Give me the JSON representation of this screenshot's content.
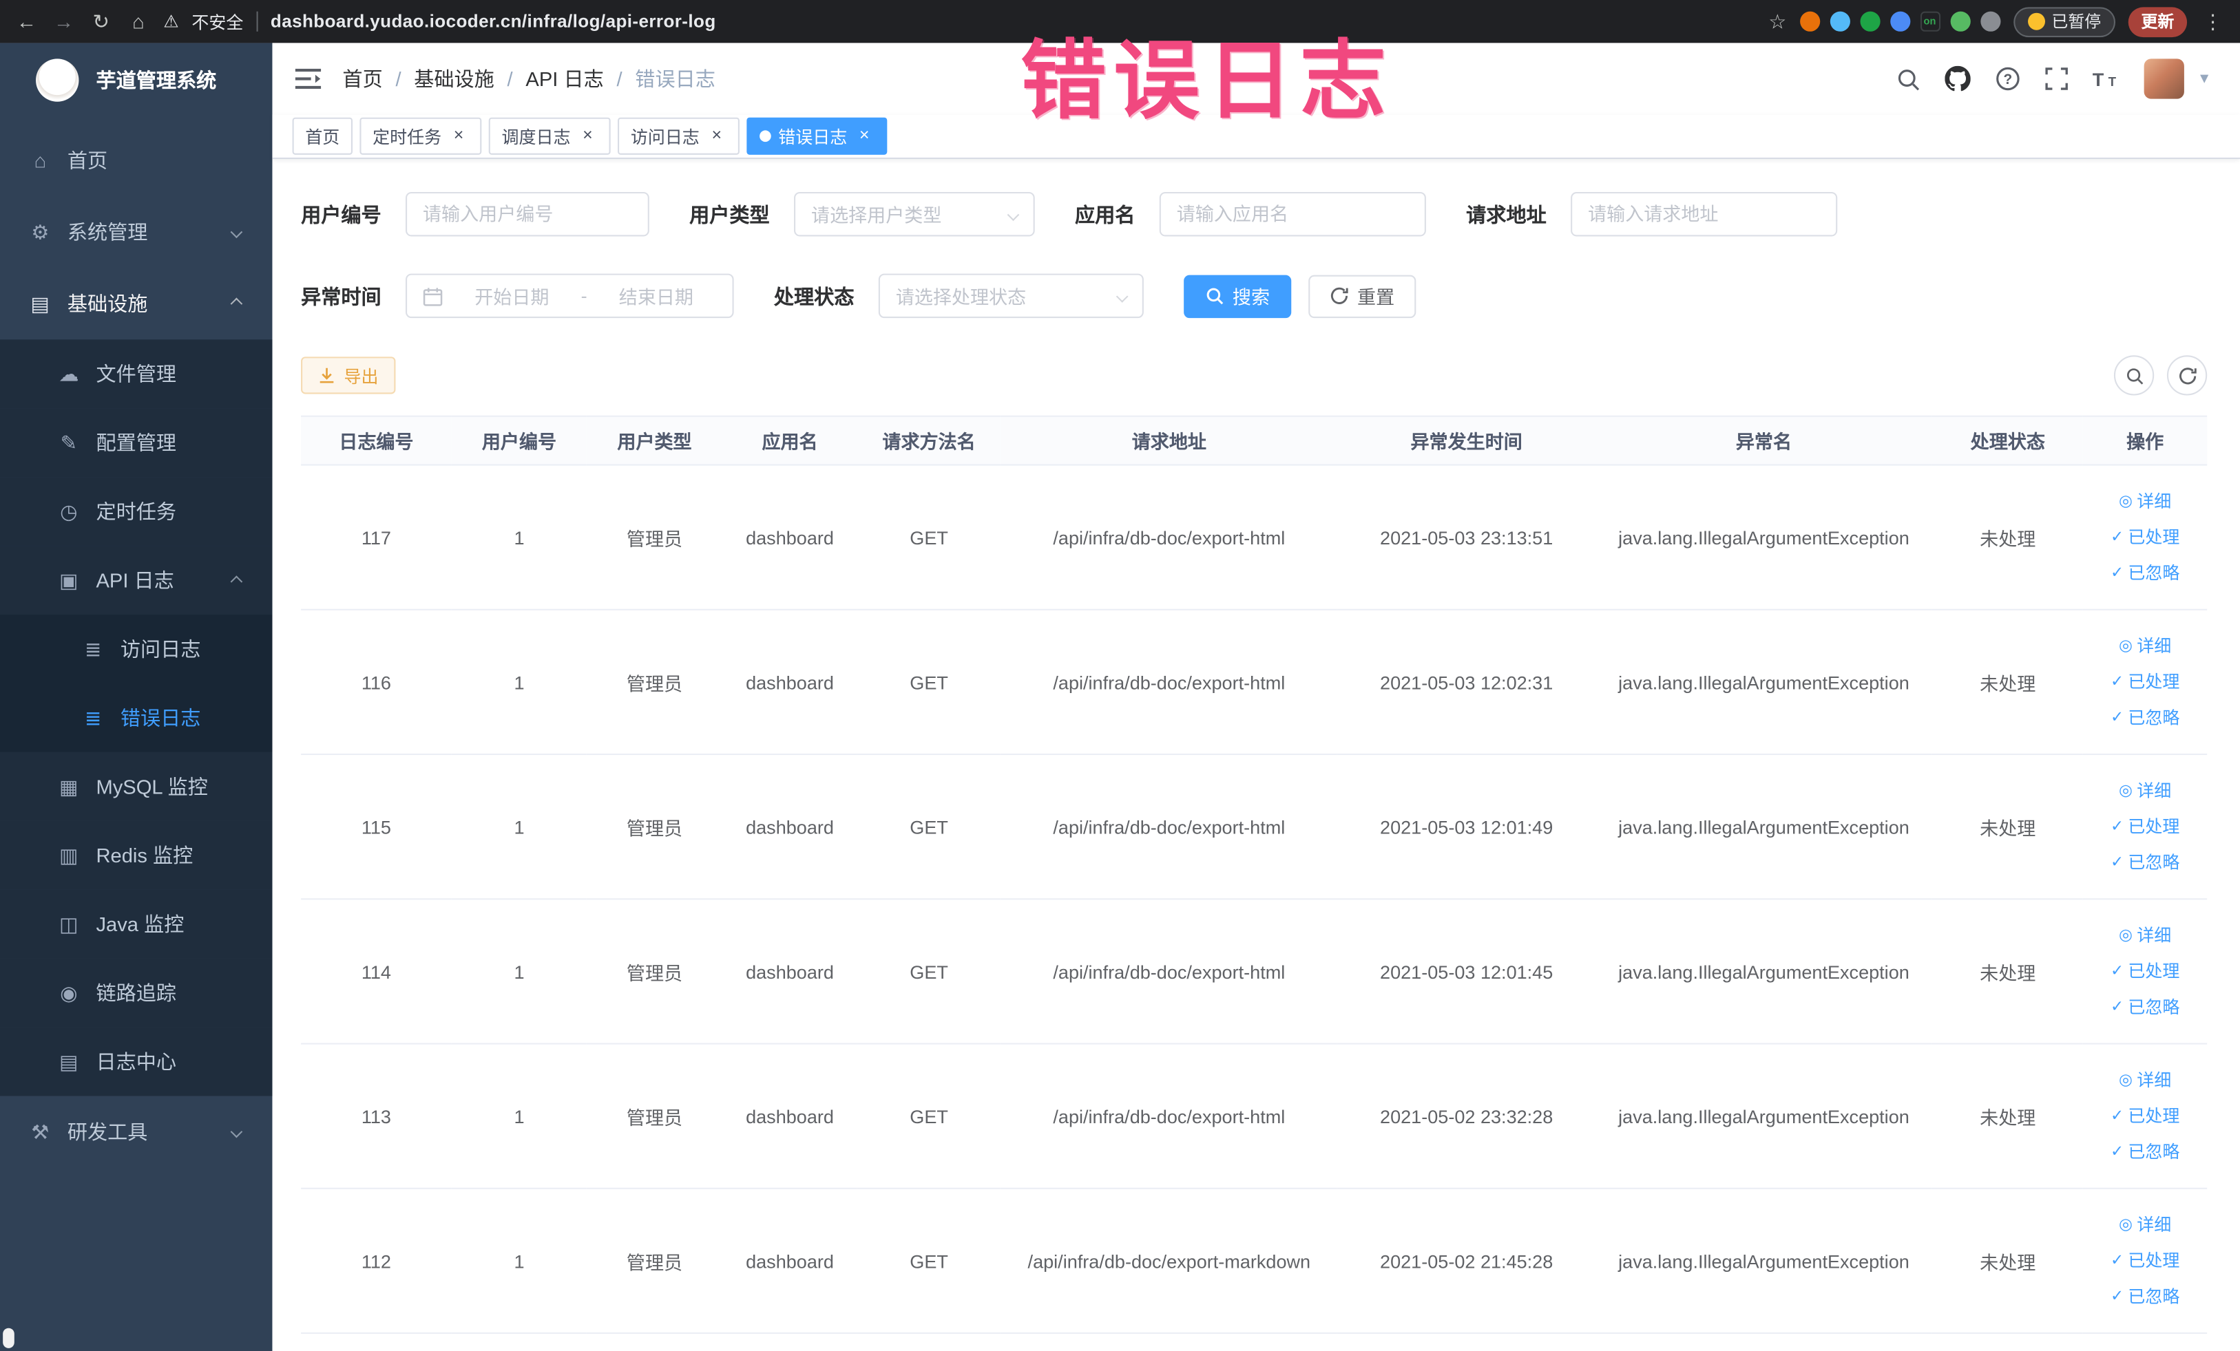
{
  "colors": {
    "primary": "#409EFF",
    "warning": "#e6a23c",
    "sidebar_bg": "#304156",
    "submenu_bg": "#1f2d3d",
    "annotation_pink": "#f1487f"
  },
  "annotation": {
    "text": "错误日志"
  },
  "browser": {
    "security_label": "不安全",
    "url": "dashboard.yudao.iocoder.cn/infra/log/api-error-log",
    "paused_label": "已暂停",
    "update_label": "更新",
    "extensions": [
      {
        "name": "extension-orange-icon",
        "color": "#e8710a"
      },
      {
        "name": "extension-blue-drop-icon",
        "color": "#54b9f7"
      },
      {
        "name": "extension-green-check-icon",
        "color": "#1ea446"
      },
      {
        "name": "extension-grid-icon",
        "color": "#4c8bf5"
      },
      {
        "name": "extension-on-badge-icon",
        "color": "#202124",
        "text": "on"
      },
      {
        "name": "extension-leaf-icon",
        "color": "#57bb63"
      },
      {
        "name": "extension-puzzle-icon",
        "color": "#8a8d93"
      }
    ]
  },
  "sidebar": {
    "title": "芋道管理系统",
    "items": [
      {
        "id": "home",
        "label": "首页",
        "icon": "dashboard-icon",
        "glyph": "⌂",
        "level": 1
      },
      {
        "id": "system",
        "label": "系统管理",
        "icon": "gear-icon",
        "glyph": "⚙",
        "level": 1,
        "arrow": "down"
      },
      {
        "id": "infra",
        "label": "基础设施",
        "icon": "monitor-icon",
        "glyph": "▤",
        "level": 1,
        "arrow": "up",
        "open": true
      },
      {
        "id": "file",
        "label": "文件管理",
        "icon": "cloud-upload-icon",
        "glyph": "☁",
        "level": 2
      },
      {
        "id": "config",
        "label": "配置管理",
        "icon": "edit-icon",
        "glyph": "✎",
        "level": 2
      },
      {
        "id": "job",
        "label": "定时任务",
        "icon": "clock-icon",
        "glyph": "◷",
        "level": 2
      },
      {
        "id": "api-log",
        "label": "API 日志",
        "icon": "log-icon",
        "glyph": "▣",
        "level": 2,
        "arrow": "up"
      },
      {
        "id": "access-log",
        "label": "访问日志",
        "icon": "document-icon",
        "glyph": "≣",
        "level": 3
      },
      {
        "id": "error-log",
        "label": "错误日志",
        "icon": "document-icon",
        "glyph": "≣",
        "level": 3,
        "active": true
      },
      {
        "id": "mysql",
        "label": "MySQL 监控",
        "icon": "database-icon",
        "glyph": "▦",
        "level": 2
      },
      {
        "id": "redis",
        "label": "Redis 监控",
        "icon": "database-icon",
        "glyph": "▥",
        "level": 2
      },
      {
        "id": "java",
        "label": "Java 监控",
        "icon": "java-monitor-icon",
        "glyph": "◫",
        "level": 2
      },
      {
        "id": "tracing",
        "label": "链路追踪",
        "icon": "eye-icon",
        "glyph": "◉",
        "level": 2
      },
      {
        "id": "log-center",
        "label": "日志中心",
        "icon": "log-center-icon",
        "glyph": "▤",
        "level": 2
      },
      {
        "id": "dev-tools",
        "label": "研发工具",
        "icon": "toolbox-icon",
        "glyph": "⚒",
        "level": 1,
        "arrow": "down"
      }
    ]
  },
  "navbar": {
    "breadcrumb": [
      "首页",
      "基础设施",
      "API 日志",
      "错误日志"
    ]
  },
  "tabs": [
    {
      "label": "首页",
      "closable": false,
      "active": false
    },
    {
      "label": "定时任务",
      "closable": true,
      "active": false
    },
    {
      "label": "调度日志",
      "closable": true,
      "active": false
    },
    {
      "label": "访问日志",
      "closable": true,
      "active": false
    },
    {
      "label": "错误日志",
      "closable": true,
      "active": true
    }
  ],
  "filters": {
    "fields": [
      {
        "label": "用户编号",
        "type": "input",
        "placeholder": "请输入用户编号"
      },
      {
        "label": "用户类型",
        "type": "select",
        "placeholder": "请选择用户类型"
      },
      {
        "label": "应用名",
        "type": "input",
        "placeholder": "请输入应用名"
      },
      {
        "label": "请求地址",
        "type": "input",
        "placeholder": "请输入请求地址"
      },
      {
        "label": "异常时间",
        "type": "daterange",
        "start_placeholder": "开始日期",
        "separator": "-",
        "end_placeholder": "结束日期"
      },
      {
        "label": "处理状态",
        "type": "select",
        "placeholder": "请选择处理状态"
      }
    ],
    "search_label": "搜索",
    "reset_label": "重置"
  },
  "toolbar": {
    "export_label": "导出"
  },
  "table": {
    "columns": [
      "日志编号",
      "用户编号",
      "用户类型",
      "应用名",
      "请求方法名",
      "请求地址",
      "异常发生时间",
      "异常名",
      "处理状态",
      "操作"
    ],
    "rows": [
      {
        "id": "117",
        "user_id": "1",
        "user_type": "管理员",
        "app_name": "dashboard",
        "method": "GET",
        "url": "/api/infra/db-doc/export-html",
        "time": "2021-05-03 23:13:51",
        "exception": "java.lang.IllegalArgumentException",
        "status": "未处理"
      },
      {
        "id": "116",
        "user_id": "1",
        "user_type": "管理员",
        "app_name": "dashboard",
        "method": "GET",
        "url": "/api/infra/db-doc/export-html",
        "time": "2021-05-03 12:02:31",
        "exception": "java.lang.IllegalArgumentException",
        "status": "未处理"
      },
      {
        "id": "115",
        "user_id": "1",
        "user_type": "管理员",
        "app_name": "dashboard",
        "method": "GET",
        "url": "/api/infra/db-doc/export-html",
        "time": "2021-05-03 12:01:49",
        "exception": "java.lang.IllegalArgumentException",
        "status": "未处理"
      },
      {
        "id": "114",
        "user_id": "1",
        "user_type": "管理员",
        "app_name": "dashboard",
        "method": "GET",
        "url": "/api/infra/db-doc/export-html",
        "time": "2021-05-03 12:01:45",
        "exception": "java.lang.IllegalArgumentException",
        "status": "未处理"
      },
      {
        "id": "113",
        "user_id": "1",
        "user_type": "管理员",
        "app_name": "dashboard",
        "method": "GET",
        "url": "/api/infra/db-doc/export-html",
        "time": "2021-05-02 23:32:28",
        "exception": "java.lang.IllegalArgumentException",
        "status": "未处理"
      },
      {
        "id": "112",
        "user_id": "1",
        "user_type": "管理员",
        "app_name": "dashboard",
        "method": "GET",
        "url": "/api/infra/db-doc/export-markdown",
        "time": "2021-05-02 21:45:28",
        "exception": "java.lang.IllegalArgumentException",
        "status": "未处理"
      }
    ],
    "row_actions": [
      {
        "name": "detail",
        "label": "详细",
        "icon": "eye-icon",
        "glyph": "◎"
      },
      {
        "name": "processed",
        "label": "已处理",
        "icon": "check-icon",
        "glyph": "✓"
      },
      {
        "name": "ignored",
        "label": "已忽略",
        "icon": "check-icon",
        "glyph": "✓"
      }
    ]
  }
}
